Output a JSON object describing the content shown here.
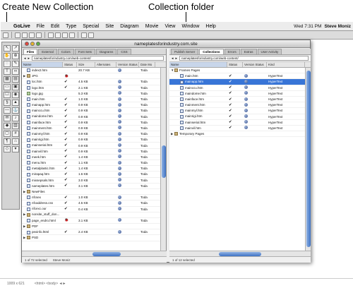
{
  "callouts": {
    "create_new_collection": "Create New Collection",
    "collection_folder": "Collection folder"
  },
  "menubar": {
    "app_name": "GoLive",
    "items": [
      "File",
      "Edit",
      "Type",
      "Special",
      "Site",
      "Diagram",
      "Movie",
      "View",
      "Window",
      "Help"
    ],
    "clock": "Wed 7:31 PM",
    "user": "Steve Moniz"
  },
  "site_window": {
    "title": "nameplatesforindustry.com.site",
    "left_pane": {
      "tabs": [
        "Files",
        "External",
        "Colors",
        "Font Sets",
        "Diagrams",
        "CSS"
      ],
      "active_tab": "Files",
      "path": "nameplatesforindustry.com/web-content/",
      "columns": [
        "Name",
        "Status",
        "Size",
        "Alternates",
        "Version Status",
        "Date Mo"
      ],
      "rows": [
        {
          "name": "index2.htm",
          "kind": "file",
          "status": "",
          "size": "20.7 KB",
          "date": "Toda",
          "disclose": ""
        },
        {
          "name": "JPG",
          "kind": "folder",
          "status": "bug",
          "size": "",
          "date": "",
          "disclose": "▶"
        },
        {
          "name": "loc.htm",
          "kind": "file",
          "status": "✔",
          "size": "4.5 KB",
          "date": "Toda",
          "disclose": ""
        },
        {
          "name": "logo.htm",
          "kind": "file",
          "status": "✔",
          "size": "2.1 KB",
          "date": "Toda",
          "disclose": ""
        },
        {
          "name": "logo.jpg",
          "kind": "img",
          "status": "",
          "size": "5.3 KB",
          "date": "Toda",
          "disclose": ""
        },
        {
          "name": "main.htm",
          "kind": "file",
          "status": "✔",
          "size": "1.0 KB",
          "date": "Toda",
          "disclose": ""
        },
        {
          "name": "mainapp.htm",
          "kind": "file",
          "status": "✔",
          "size": "0.9 KB",
          "date": "Toda",
          "disclose": ""
        },
        {
          "name": "mainccu.htm",
          "kind": "file",
          "status": "✔",
          "size": "0.9 KB",
          "date": "Toda",
          "disclose": ""
        },
        {
          "name": "maindome.htm",
          "kind": "file",
          "status": "✔",
          "size": "0.9 KB",
          "date": "Toda",
          "disclose": ""
        },
        {
          "name": "mainface.htm",
          "kind": "file",
          "status": "✔",
          "size": "0.9 KB",
          "date": "Toda",
          "disclose": ""
        },
        {
          "name": "mainment.htm",
          "kind": "file",
          "status": "✔",
          "size": "0.9 KB",
          "date": "Toda",
          "disclose": ""
        },
        {
          "name": "mainmyl.htm",
          "kind": "file",
          "status": "✔",
          "size": "0.9 KB",
          "date": "Toda",
          "disclose": ""
        },
        {
          "name": "mainrigi.htm",
          "kind": "file",
          "status": "✔",
          "size": "0.9 KB",
          "date": "Toda",
          "disclose": ""
        },
        {
          "name": "mainserial.htm",
          "kind": "file",
          "status": "✔",
          "size": "0.9 KB",
          "date": "Toda",
          "disclose": ""
        },
        {
          "name": "mainvil.htm",
          "kind": "file",
          "status": "✔",
          "size": "0.9 KB",
          "date": "Toda",
          "disclose": ""
        },
        {
          "name": "meek.htm",
          "kind": "file",
          "status": "✔",
          "size": "1.4 KB",
          "date": "Toda",
          "disclose": ""
        },
        {
          "name": "menu.htm",
          "kind": "file",
          "status": "✔",
          "size": "1.1 KB",
          "date": "Toda",
          "disclose": ""
        },
        {
          "name": "metalplastic.htm",
          "kind": "file",
          "status": "✔",
          "size": "1.4 KB",
          "date": "Toda",
          "disclose": ""
        },
        {
          "name": "mirapaq.htm",
          "kind": "file",
          "status": "✔",
          "size": "1.6 KB",
          "date": "Toda",
          "disclose": ""
        },
        {
          "name": "mixsepsals.htm",
          "kind": "file",
          "status": "✔",
          "size": "3.0 KB",
          "date": "Toda",
          "disclose": ""
        },
        {
          "name": "nameplates.htm",
          "kind": "file",
          "status": "✔",
          "size": "3.1 KB",
          "date": "Toda",
          "disclose": ""
        },
        {
          "name": "NewFiles",
          "kind": "folder",
          "status": "",
          "size": "",
          "date": "",
          "disclose": "▶"
        },
        {
          "name": "nfcsex",
          "kind": "file",
          "status": "✔",
          "size": "1.0 KB",
          "date": "Toda",
          "disclose": ""
        },
        {
          "name": "nfcaddress.css",
          "kind": "file",
          "status": "✔",
          "size": "4.5 KB",
          "date": "Toda",
          "disclose": ""
        },
        {
          "name": "nfcexc.our",
          "kind": "file",
          "status": "✔",
          "size": "0.4 KB",
          "date": "Toda",
          "disclose": ""
        },
        {
          "name": "nonsite_stuff_don...",
          "kind": "folder",
          "status": "",
          "size": "",
          "date": "",
          "disclose": "▶"
        },
        {
          "name": "page_endro.html",
          "kind": "file",
          "status": "bug",
          "size": "3.1 KB",
          "date": "Toda",
          "disclose": ""
        },
        {
          "name": "PDF",
          "kind": "folder",
          "status": "",
          "size": "",
          "date": "",
          "disclose": "▶"
        },
        {
          "name": "pexinfo.html",
          "kind": "file",
          "status": "✔",
          "size": "2.4 KB",
          "date": "Toda",
          "disclose": ""
        },
        {
          "name": "PSD",
          "kind": "folder",
          "status": "",
          "size": "",
          "date": "",
          "disclose": "▶"
        }
      ],
      "footer": {
        "selection": "1 of 72 selected",
        "owner": "Steve Moniz"
      }
    },
    "right_pane": {
      "tabs": [
        "Publish Server",
        "Collections",
        "Errors",
        "Extras",
        "User Activity"
      ],
      "active_tab": "Collections",
      "path": "nameplatesforindustry.com/web-content/",
      "columns": [
        "Name",
        "Status",
        "Version Status",
        "Kind"
      ],
      "rows": [
        {
          "name": "Frames Pages",
          "level": 0,
          "kind_label": "",
          "status": "",
          "disclose": "▼",
          "selected": false
        },
        {
          "name": "main.htm",
          "level": 1,
          "kind_label": "HyperText",
          "status": "✔",
          "disclose": "",
          "selected": false
        },
        {
          "name": "mainapp.htm",
          "level": 1,
          "kind_label": "HyperText",
          "status": "✔",
          "disclose": "",
          "selected": true
        },
        {
          "name": "mainccu.htm",
          "level": 1,
          "kind_label": "HyperText",
          "status": "✔",
          "disclose": "",
          "selected": false
        },
        {
          "name": "maindome.htm",
          "level": 1,
          "kind_label": "HyperText",
          "status": "✔",
          "disclose": "",
          "selected": false
        },
        {
          "name": "mainface.htm",
          "level": 1,
          "kind_label": "HyperText",
          "status": "✔",
          "disclose": "",
          "selected": false
        },
        {
          "name": "mainment.htm",
          "level": 1,
          "kind_label": "HyperText",
          "status": "✔",
          "disclose": "",
          "selected": false
        },
        {
          "name": "mainmyl.htm",
          "level": 1,
          "kind_label": "HyperText",
          "status": "✔",
          "disclose": "",
          "selected": false
        },
        {
          "name": "mainrigi.htm",
          "level": 1,
          "kind_label": "HyperText",
          "status": "✔",
          "disclose": "",
          "selected": false
        },
        {
          "name": "mainserial.htm",
          "level": 1,
          "kind_label": "HyperText",
          "status": "✔",
          "disclose": "",
          "selected": false
        },
        {
          "name": "mainvil.htm",
          "level": 1,
          "kind_label": "HyperText",
          "status": "✔",
          "disclose": "",
          "selected": false
        },
        {
          "name": "Temporary Pages",
          "level": 0,
          "kind_label": "",
          "status": "",
          "disclose": "▶",
          "selected": false
        }
      ],
      "footer": {
        "selection": "1 of 12 selected"
      }
    }
  },
  "status_bar": {
    "items": [
      "1009 x 621",
      "<html> <body> ◄►"
    ]
  }
}
